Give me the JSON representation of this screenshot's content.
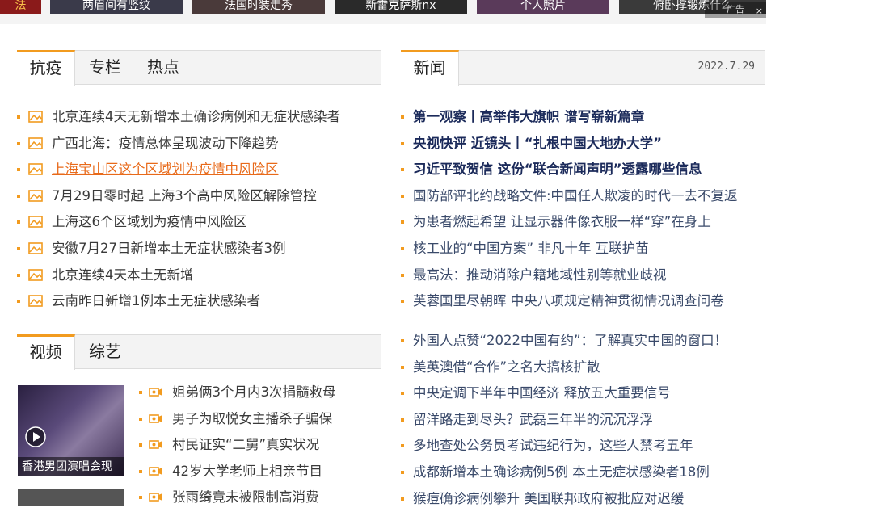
{
  "top_strip": {
    "thumbs": [
      "法",
      "两眉间有竖纹",
      "法国时装走秀",
      "新雷克萨斯nx",
      "个人照片",
      "俯卧撑锻炼什么"
    ],
    "ad_label": "广告",
    "ad_close": "×"
  },
  "left_top": {
    "tabs": [
      "抗疫",
      "专栏",
      "热点"
    ],
    "items": [
      "北京连续4天无新增本土确诊病例和无症状感染者",
      "广西北海：疫情总体呈现波动下降趋势",
      "上海宝山区这个区域划为疫情中风险区",
      "7月29日零时起 上海3个高中风险区解除管控",
      "上海这6个区域划为疫情中风险区",
      "安徽7月27日新增本土无症状感染者3例",
      "北京连续4天本土无新增",
      "云南昨日新增1例本土无症状感染者"
    ]
  },
  "left_bottom": {
    "tabs": [
      "视频",
      "综艺"
    ],
    "video_caption": "香港男团演唱会现",
    "items": [
      "姐弟俩3个月内3次捐髓救母",
      "男子为取悦女主播杀子骗保",
      "村民证实“二舅”真实状况",
      "42岁大学老师上相亲节目",
      "张雨绮竟未被限制高消费"
    ]
  },
  "news": {
    "tab": "新闻",
    "date": "2022.7.29",
    "group1": [
      "第一观察丨高举伟大旗帜 谱写崭新篇章",
      "央视快评 近镜头丨“扎根中国大地办大学”",
      "习近平致贺信 这份“联合新闻声明”透露哪些信息",
      "国防部评北约战略文件:中国任人欺凌的时代一去不复返",
      "为患者燃起希望 让显示器件像衣服一样“穿”在身上",
      "核工业的“中国方案” 非凡十年 互联护苗",
      "最高法：推动消除户籍地域性别等就业歧视",
      "芙蓉国里尽朝晖 中央八项规定精神贯彻情况调查问卷"
    ],
    "group2": [
      "外国人点赞“2022中国有约”：了解真实中国的窗口！",
      "美英澳借“合作”之名大搞核扩散",
      "中央定调下半年中国经济 释放五大重要信号",
      "留洋路走到尽头？武磊三年半的沉沉浮浮",
      "多地查处公务员考试违纪行为，这些人禁考五年",
      "成都新增本土确诊病例5例 本土无症状感染者18例",
      "猴痘确诊病例攀升 美国联邦政府被批应对迟缓"
    ]
  },
  "colors": {
    "accent": "#f29b1f",
    "link_hover": "#e86a1a",
    "news_bold": "#1b2a5a"
  }
}
